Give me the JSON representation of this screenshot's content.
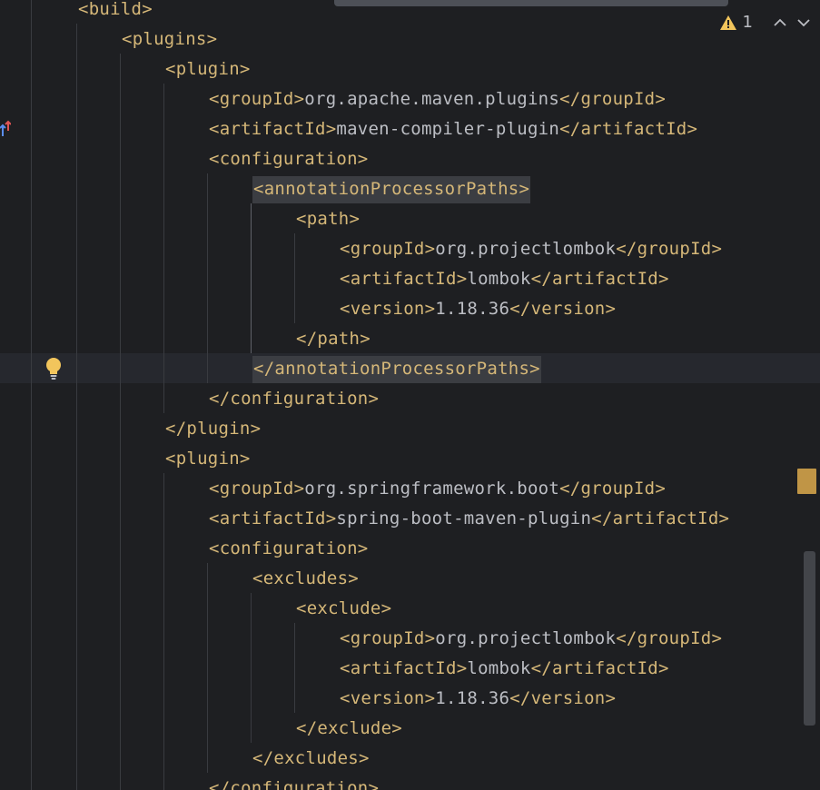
{
  "inspection": {
    "warning_count": "1",
    "warning_icon": "warning-triangle-icon",
    "prev_icon": "chevron-up-icon",
    "next_icon": "chevron-down-icon"
  },
  "colors": {
    "background": "#1e1f22",
    "tag": "#d5b778",
    "text": "#bcbec4",
    "warning": "#c09546",
    "current_line": "#26282e",
    "tag_highlight": "#3b3d42"
  },
  "code": {
    "lines": [
      [
        {
          "t": "<build>",
          "c": "tag"
        }
      ],
      [
        {
          "t": "<plugins>",
          "c": "tag"
        }
      ],
      [
        {
          "t": "<plugin>",
          "c": "tag"
        }
      ],
      [
        {
          "t": "<groupId>",
          "c": "tag"
        },
        {
          "t": "org.apache.maven.plugins",
          "c": "txt"
        },
        {
          "t": "</groupId>",
          "c": "tag"
        }
      ],
      [
        {
          "t": "<artifactId>",
          "c": "tag"
        },
        {
          "t": "maven-compiler-plugin",
          "c": "txt"
        },
        {
          "t": "</artifactId>",
          "c": "tag"
        }
      ],
      [
        {
          "t": "<configuration>",
          "c": "tag"
        }
      ],
      [
        {
          "t": "<annotationProcessorPaths>",
          "c": "tag",
          "hl": true
        }
      ],
      [
        {
          "t": "<path>",
          "c": "tag"
        }
      ],
      [
        {
          "t": "<groupId>",
          "c": "tag"
        },
        {
          "t": "org.projectlombok",
          "c": "txt"
        },
        {
          "t": "</groupId>",
          "c": "tag"
        }
      ],
      [
        {
          "t": "<artifactId>",
          "c": "tag"
        },
        {
          "t": "lombok",
          "c": "txt"
        },
        {
          "t": "</artifactId>",
          "c": "tag"
        }
      ],
      [
        {
          "t": "<version>",
          "c": "tag"
        },
        {
          "t": "1.18.36",
          "c": "txt"
        },
        {
          "t": "</version>",
          "c": "tag"
        }
      ],
      [
        {
          "t": "</path>",
          "c": "tag"
        }
      ],
      [
        {
          "t": "</annotationProcessorPaths>",
          "c": "tag",
          "hl": true
        }
      ],
      [
        {
          "t": "</configuration>",
          "c": "tag"
        }
      ],
      [
        {
          "t": "</plugin>",
          "c": "tag"
        }
      ],
      [
        {
          "t": "<plugin>",
          "c": "tag"
        }
      ],
      [
        {
          "t": "<groupId>",
          "c": "tag"
        },
        {
          "t": "org.springframework.boot",
          "c": "txt"
        },
        {
          "t": "</groupId>",
          "c": "tag"
        }
      ],
      [
        {
          "t": "<artifactId>",
          "c": "tag"
        },
        {
          "t": "spring-boot-maven-plugin",
          "c": "txt"
        },
        {
          "t": "</artifactId>",
          "c": "tag"
        }
      ],
      [
        {
          "t": "<configuration>",
          "c": "tag"
        }
      ],
      [
        {
          "t": "<excludes>",
          "c": "tag"
        }
      ],
      [
        {
          "t": "<exclude>",
          "c": "tag"
        }
      ],
      [
        {
          "t": "<groupId>",
          "c": "tag"
        },
        {
          "t": "org.projectlombok",
          "c": "txt"
        },
        {
          "t": "</groupId>",
          "c": "tag"
        }
      ],
      [
        {
          "t": "<artifactId>",
          "c": "tag"
        },
        {
          "t": "lombok",
          "c": "txt"
        },
        {
          "t": "</artifactId>",
          "c": "tag"
        }
      ],
      [
        {
          "t": "<version>",
          "c": "tag"
        },
        {
          "t": "1.18.36",
          "c": "txt"
        },
        {
          "t": "</version>",
          "c": "tag"
        }
      ],
      [
        {
          "t": "</exclude>",
          "c": "tag"
        }
      ],
      [
        {
          "t": "</excludes>",
          "c": "tag"
        }
      ],
      [
        {
          "t": "</configuration>",
          "c": "tag"
        }
      ]
    ]
  },
  "gutter": {
    "intention_icon": "lightbulb-icon",
    "vcs_icon": "override-arrows-icon"
  }
}
